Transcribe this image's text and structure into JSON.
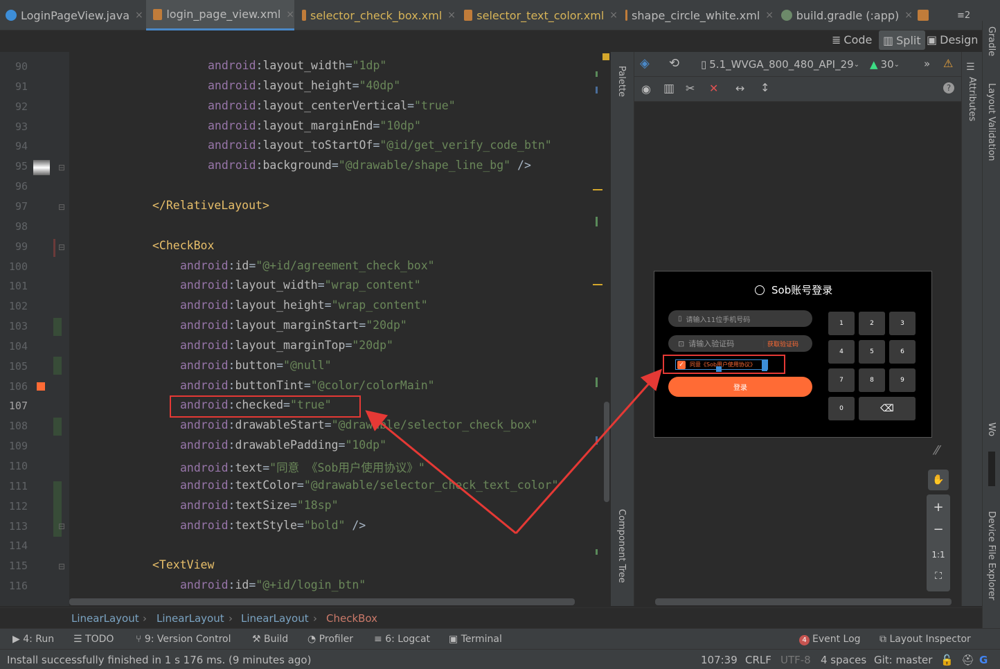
{
  "tabs": [
    {
      "label": "LoginPageView.java",
      "type": "java"
    },
    {
      "label": "login_page_view.xml",
      "type": "xml",
      "active": true
    },
    {
      "label": "selector_check_box.xml",
      "type": "xml"
    },
    {
      "label": "selector_text_color.xml",
      "type": "xml"
    },
    {
      "label": "shape_circle_white.xml",
      "type": "xml"
    },
    {
      "label": "build.gradle (:app)",
      "type": "gradle"
    }
  ],
  "tab_overflow": "≡2",
  "view_modes": {
    "code": "Code",
    "split": "Split",
    "design": "Design"
  },
  "line_numbers": [
    "90",
    "91",
    "92",
    "93",
    "94",
    "95",
    "96",
    "97",
    "98",
    "99",
    "100",
    "101",
    "102",
    "103",
    "104",
    "105",
    "106",
    "107",
    "108",
    "109",
    "110",
    "111",
    "112",
    "113",
    "114",
    "115",
    "116"
  ],
  "current_line": "107",
  "code_lines": [
    {
      "indent": 16,
      "ns": "android",
      "attr": "layout_width",
      "val": "\"1dp\""
    },
    {
      "indent": 16,
      "ns": "android",
      "attr": "layout_height",
      "val": "\"40dp\""
    },
    {
      "indent": 16,
      "ns": "android",
      "attr": "layout_centerVertical",
      "val": "\"true\""
    },
    {
      "indent": 16,
      "ns": "android",
      "attr": "layout_marginEnd",
      "val": "\"10dp\""
    },
    {
      "indent": 16,
      "ns": "android",
      "attr": "layout_toStartOf",
      "val": "\"@id/get_verify_code_btn\""
    },
    {
      "indent": 16,
      "ns": "android",
      "attr": "background",
      "val": "\"@drawable/shape_line_bg\"",
      "close": " />"
    },
    {
      "blank": true
    },
    {
      "indent": 8,
      "tag": "</RelativeLayout>"
    },
    {
      "blank": true
    },
    {
      "indent": 8,
      "tag": "<CheckBox"
    },
    {
      "indent": 12,
      "ns": "android",
      "attr": "id",
      "val": "\"@+id/agreement_check_box\""
    },
    {
      "indent": 12,
      "ns": "android",
      "attr": "layout_width",
      "val": "\"wrap_content\""
    },
    {
      "indent": 12,
      "ns": "android",
      "attr": "layout_height",
      "val": "\"wrap_content\""
    },
    {
      "indent": 12,
      "ns": "android",
      "attr": "layout_marginStart",
      "val": "\"20dp\""
    },
    {
      "indent": 12,
      "ns": "android",
      "attr": "layout_marginTop",
      "val": "\"20dp\""
    },
    {
      "indent": 12,
      "ns": "android",
      "attr": "button",
      "val": "\"@null\""
    },
    {
      "indent": 12,
      "ns": "android",
      "attr": "buttonTint",
      "val": "\"@color/colorMain\""
    },
    {
      "indent": 12,
      "ns": "android",
      "attr": "checked",
      "val": "\"true\""
    },
    {
      "indent": 12,
      "ns": "android",
      "attr": "drawableStart",
      "val": "\"@drawable/selector_check_box\""
    },
    {
      "indent": 12,
      "ns": "android",
      "attr": "drawablePadding",
      "val": "\"10dp\""
    },
    {
      "indent": 12,
      "ns": "android",
      "attr": "text",
      "val": "\"同意 《Sob用户使用协议》\""
    },
    {
      "indent": 12,
      "ns": "android",
      "attr": "textColor",
      "val": "\"@drawable/selector_check_text_color\""
    },
    {
      "indent": 12,
      "ns": "android",
      "attr": "textSize",
      "val": "\"18sp\""
    },
    {
      "indent": 12,
      "ns": "android",
      "attr": "textStyle",
      "val": "\"bold\"",
      "close": " />"
    },
    {
      "blank": true
    },
    {
      "indent": 8,
      "tag": "<TextView"
    },
    {
      "indent": 12,
      "ns": "android",
      "attr": "id",
      "val": "\"@+id/login_btn\""
    }
  ],
  "designer": {
    "device": "5.1_WVGA_800_480_API_29",
    "api": "30",
    "palette_label": "Palette",
    "component_tree_label": "Component Tree",
    "attributes_label": "Attributes",
    "preview": {
      "title": "Sob账号登录",
      "phone_placeholder": "请输入11位手机号码",
      "code_placeholder": "请输入验证码",
      "get_code": "获取验证码",
      "agreement": "同意《Sob用户使用协议》",
      "login": "登录",
      "keys": [
        "1",
        "2",
        "3",
        "4",
        "5",
        "6",
        "7",
        "8",
        "9",
        "0"
      ]
    },
    "zoom_buttons": [
      "+",
      "−",
      "1:1"
    ]
  },
  "right_sidebar": [
    "Gradle",
    "Layout Validation",
    "Wo",
    "Device File Explorer"
  ],
  "breadcrumb": [
    "LinearLayout",
    "LinearLayout",
    "LinearLayout",
    "CheckBox"
  ],
  "tool_windows": [
    {
      "label": "4: Run"
    },
    {
      "label": "TODO"
    },
    {
      "label": "9: Version Control"
    },
    {
      "label": "Build"
    },
    {
      "label": "Profiler"
    },
    {
      "label": "6: Logcat"
    },
    {
      "label": "Terminal"
    }
  ],
  "tool_windows_right": [
    {
      "label": "Event Log",
      "badge": "4"
    },
    {
      "label": "Layout Inspector"
    }
  ],
  "status": {
    "message": "Install successfully finished in 1 s 176 ms. (9 minutes ago)",
    "position": "107:39",
    "line_sep": "CRLF",
    "encoding": "UTF-8",
    "indent": "4 spaces",
    "vcs": "Git: master"
  },
  "colors": {
    "accent_orange": "#ff6b35",
    "highlight_red": "#e53935",
    "xml_value": "#6a8759",
    "xml_tag": "#e8bf6a",
    "xml_ns": "#9876aa"
  }
}
